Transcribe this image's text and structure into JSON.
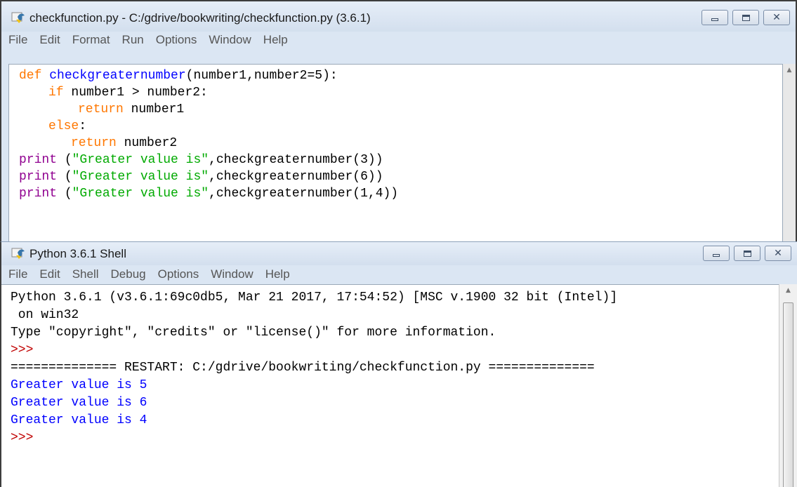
{
  "editor": {
    "title": "checkfunction.py - C:/gdrive/bookwriting/checkfunction.py (3.6.1)",
    "icon": "python-idle-icon",
    "menu": [
      "File",
      "Edit",
      "Format",
      "Run",
      "Options",
      "Window",
      "Help"
    ],
    "code": {
      "l1_kw": "def ",
      "l1_fn": "checkgreaternumber",
      "l1_rest": "(number1,number2=5):",
      "l2_kw": "if",
      "l2_rest": " number1 > number2:",
      "l3_kw": "return",
      "l3_rest": " number1",
      "l4_kw": "else",
      "l4_rest": ":",
      "l5_kw": "return",
      "l5_rest": " number2",
      "print_kw": "print",
      "str_lit": "\"Greater value is\"",
      "p1_rest": ",checkgreaternumber(3))",
      "p2_rest": ",checkgreaternumber(6))",
      "p3_rest": ",checkgreaternumber(1,4))"
    }
  },
  "shell": {
    "title": "Python 3.6.1 Shell",
    "icon": "python-idle-icon",
    "menu": [
      "File",
      "Edit",
      "Shell",
      "Debug",
      "Options",
      "Window",
      "Help"
    ],
    "lines": {
      "banner1": "Python 3.6.1 (v3.6.1:69c0db5, Mar 21 2017, 17:54:52) [MSC v.1900 32 bit (Intel)]",
      "banner2": " on win32",
      "banner3": "Type \"copyright\", \"credits\" or \"license()\" for more information.",
      "prompt1": ">>> ",
      "restart": "============== RESTART: C:/gdrive/bookwriting/checkfunction.py ==============",
      "out1": "Greater value is 5",
      "out2": "Greater value is 6",
      "out3": "Greater value is 4",
      "prompt2": ">>> "
    }
  },
  "window_controls": {
    "minimize": "minimize-icon",
    "maximize": "maximize-icon",
    "close": "close-icon",
    "close_glyph": "✕"
  },
  "colors": {
    "keyword": "#ff7700",
    "builtin": "#900090",
    "defname": "#0000ff",
    "string": "#00aa00",
    "output": "#0000ff",
    "prompt": "#c00000"
  }
}
